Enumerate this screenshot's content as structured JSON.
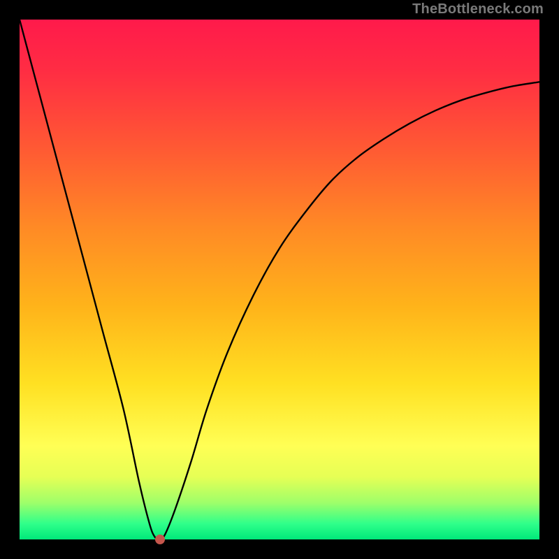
{
  "watermark": "TheBottleneck.com",
  "chart_data": {
    "type": "line",
    "title": "",
    "xlabel": "",
    "ylabel": "",
    "xlim": [
      0,
      100
    ],
    "ylim": [
      0,
      100
    ],
    "grid": false,
    "legend": false,
    "background": "rainbow-gradient-vertical",
    "series": [
      {
        "name": "bottleneck-curve",
        "color": "#000000",
        "x": [
          0,
          4,
          8,
          12,
          16,
          20,
          23,
          25,
          26,
          27,
          28,
          30,
          33,
          36,
          40,
          45,
          50,
          55,
          60,
          65,
          70,
          75,
          80,
          85,
          90,
          95,
          100
        ],
        "y": [
          100,
          85,
          70,
          55,
          40,
          25,
          11,
          3,
          0.5,
          0,
          1,
          6,
          15,
          25,
          36,
          47,
          56,
          63,
          69,
          73.5,
          77,
          80,
          82.5,
          84.5,
          86,
          87.2,
          88
        ]
      }
    ],
    "marker": {
      "name": "current-point",
      "x": 27,
      "y": 0,
      "color": "#c5564c"
    }
  }
}
